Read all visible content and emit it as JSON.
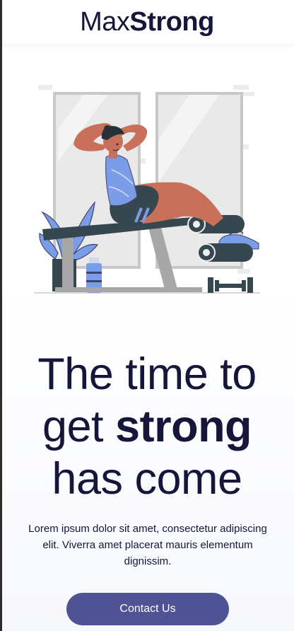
{
  "header": {
    "logo_light": "Max",
    "logo_bold": "Strong"
  },
  "hero": {
    "illustration_icon": "gym-workout-illustration",
    "headline": {
      "line1": "The time to",
      "line2_prefix": "get ",
      "line2_bold": "strong",
      "line3": "has come"
    },
    "subtext": "Lorem ipsum dolor sit amet, consectetur adipiscing elit. Viverra amet placerat mauris elementum dignissim.",
    "cta_label": "Contact Us"
  },
  "colors": {
    "primary": "#4f5396",
    "text": "#15163a",
    "accent_blue": "#7b9ce6",
    "skin": "#c8705a"
  }
}
